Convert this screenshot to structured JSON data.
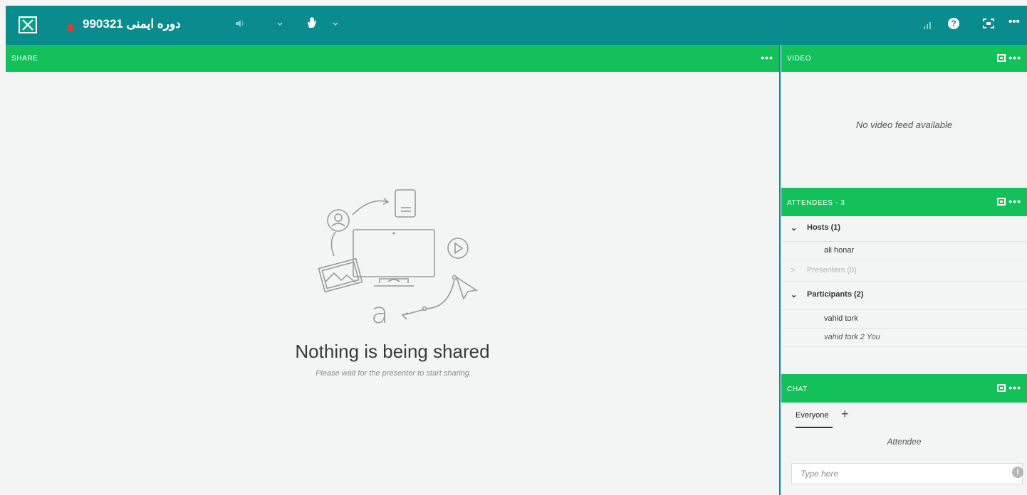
{
  "topbar": {
    "meeting_title": "دوره ایمنی 990321",
    "colors": {
      "bar": "#0a8b8e",
      "recording": "#e53935"
    }
  },
  "share_pod": {
    "title": "SHARE",
    "menu": "•••",
    "empty_title": "Nothing is being shared",
    "empty_subtitle": "Please wait for the presenter to start sharing"
  },
  "video_pod": {
    "title": "VIDEO",
    "menu": "•••",
    "message": "No video feed available"
  },
  "attendees_pod": {
    "title": "ATTENDEES - 3",
    "menu": "•••",
    "hosts_label": "Hosts (1)",
    "hosts": [
      "ali honar"
    ],
    "presenters_label": "Presenters (0)",
    "participants_label": "Participants (2)",
    "participants": [
      "vahid tork",
      "vahid tork 2 You"
    ]
  },
  "chat_pod": {
    "title": "CHAT",
    "menu": "•••",
    "tab_label": "Everyone",
    "add_label": "+",
    "section_label": "Attendee",
    "input_placeholder": "Type here"
  },
  "accent_color": "#14c05a"
}
